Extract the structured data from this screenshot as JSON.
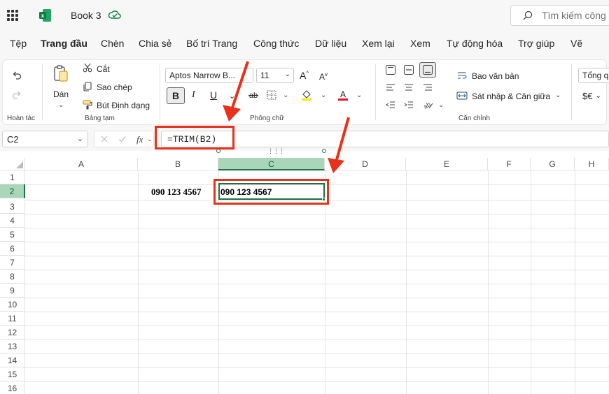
{
  "titlebar": {
    "doc_title": "Book 3",
    "search_placeholder": "Tìm kiếm công cụ"
  },
  "tabs": [
    {
      "label": "Tệp"
    },
    {
      "label": "Trang đầu"
    },
    {
      "label": "Chèn"
    },
    {
      "label": "Chia sẻ"
    },
    {
      "label": "Bố trí Trang"
    },
    {
      "label": "Công thức"
    },
    {
      "label": "Dữ liệu"
    },
    {
      "label": "Xem lại"
    },
    {
      "label": "Xem"
    },
    {
      "label": "Tự động hóa"
    },
    {
      "label": "Trợ giúp"
    },
    {
      "label": "Vẽ"
    }
  ],
  "ribbon": {
    "undo_group": "Hoàn tác",
    "clipboard": {
      "paste": "Dán",
      "cut": "Cắt",
      "copy": "Sao chép",
      "format_painter": "Bút Định dạng",
      "group": "Bảng tạm"
    },
    "font": {
      "name": "Aptos Narrow B...",
      "size": "11",
      "bold": "B",
      "italic": "I",
      "underline": "U",
      "group": "Phông chữ"
    },
    "alignment": {
      "wrap": "Bao văn bản",
      "merge": "Sát nhập & Căn giữa",
      "group": "Căn chỉnh"
    },
    "number": {
      "format": "Tổng q",
      "currency": "$€"
    }
  },
  "formula_bar": {
    "name_box": "C2",
    "formula": "=TRIM(B2)",
    "fx": "fx"
  },
  "grid": {
    "columns": [
      "A",
      "B",
      "C",
      "D",
      "E",
      "F",
      "G",
      "H"
    ],
    "rows": [
      "1",
      "2",
      "3",
      "4",
      "5",
      "6",
      "7",
      "8",
      "9",
      "10",
      "11",
      "12",
      "13",
      "14",
      "15",
      "16"
    ],
    "b2": "090 123 4567",
    "c2": "090 123 4567"
  },
  "colors": {
    "accent": "#1e7145",
    "selection": "#a9d6b8",
    "annotation": "#e8301a"
  }
}
